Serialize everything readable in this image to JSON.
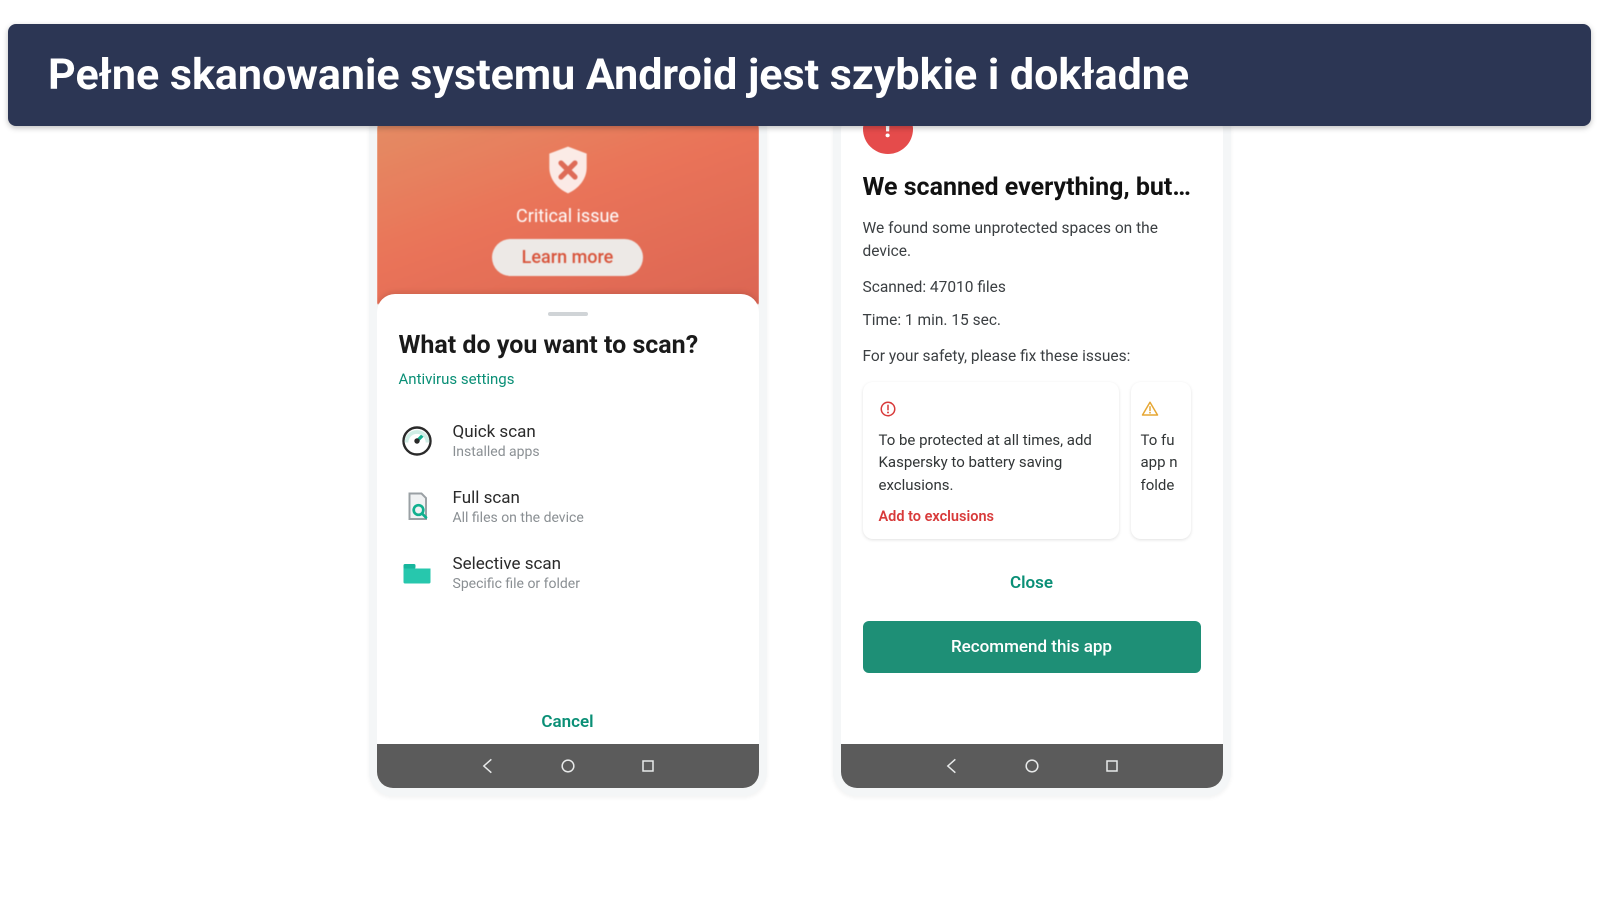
{
  "banner": {
    "text": "Pełne skanowanie systemu Android jest szybkie i dokładne"
  },
  "phone1": {
    "hero_label": "Critical issue",
    "learn_more": "Learn more",
    "sheet_title": "What do you want to scan?",
    "settings_link": "Antivirus settings",
    "options": [
      {
        "title": "Quick scan",
        "sub": "Installed apps"
      },
      {
        "title": "Full scan",
        "sub": "All files on the device"
      },
      {
        "title": "Selective scan",
        "sub": "Specific file or folder"
      }
    ],
    "cancel": "Cancel"
  },
  "phone2": {
    "title": "We scanned everything, but…",
    "desc": "We found some unprotected spaces on the device.",
    "scanned_line": "Scanned: 47010 files",
    "time_line": "Time: 1 min. 15 sec.",
    "fix_prompt": "For your safety, please fix these issues:",
    "issue1_body": "To be protected at all times, add Kaspersky to battery saving exclusions.",
    "issue1_action": "Add to exclusions",
    "issue2_snippet": "To fu\napp n\nfolde",
    "close": "Close",
    "recommend": "Recommend this app"
  }
}
